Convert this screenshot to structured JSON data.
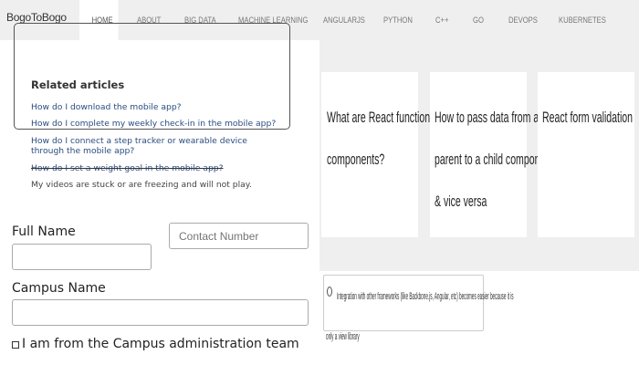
{
  "brand": "BogoToBogo",
  "nav": {
    "items": [
      {
        "label": "HOME",
        "active": true
      },
      {
        "label": "ABOUT"
      },
      {
        "label": "BIG DATA"
      },
      {
        "label": "MACHINE LEARNING"
      },
      {
        "label": "ANGULARJS"
      },
      {
        "label": "PYTHON"
      },
      {
        "label": "C++"
      },
      {
        "label": "GO"
      },
      {
        "label": "DEVOPS"
      },
      {
        "label": "KUBERNETES"
      }
    ]
  },
  "related": {
    "title": "Related articles",
    "articles": [
      "How do I download the mobile app?",
      "How do I complete my weekly check-in in the mobile app?",
      "How do I connect a step tracker or wearable device through the mobile app?",
      "How do I set a weight goal in the mobile app?",
      "My videos are stuck or are freezing and will not play."
    ]
  },
  "form": {
    "full_name_label": "Full Name",
    "contact_placeholder": "Contact Number",
    "campus_name_label": "Campus Name",
    "admin_checkbox_label": "I am from the Campus administration team"
  },
  "cards": [
    {
      "lines": [
        "What are React functional",
        "components?"
      ]
    },
    {
      "lines": [
        "How to pass data from a",
        "parent to a child component",
        "& vice versa"
      ]
    },
    {
      "lines": [
        "React form validation"
      ]
    }
  ],
  "snippet": {
    "line1": "Integration with other frameworks (like Backbone.js, Angular, etc) becomes easier because it is",
    "line2": "only a view library"
  }
}
